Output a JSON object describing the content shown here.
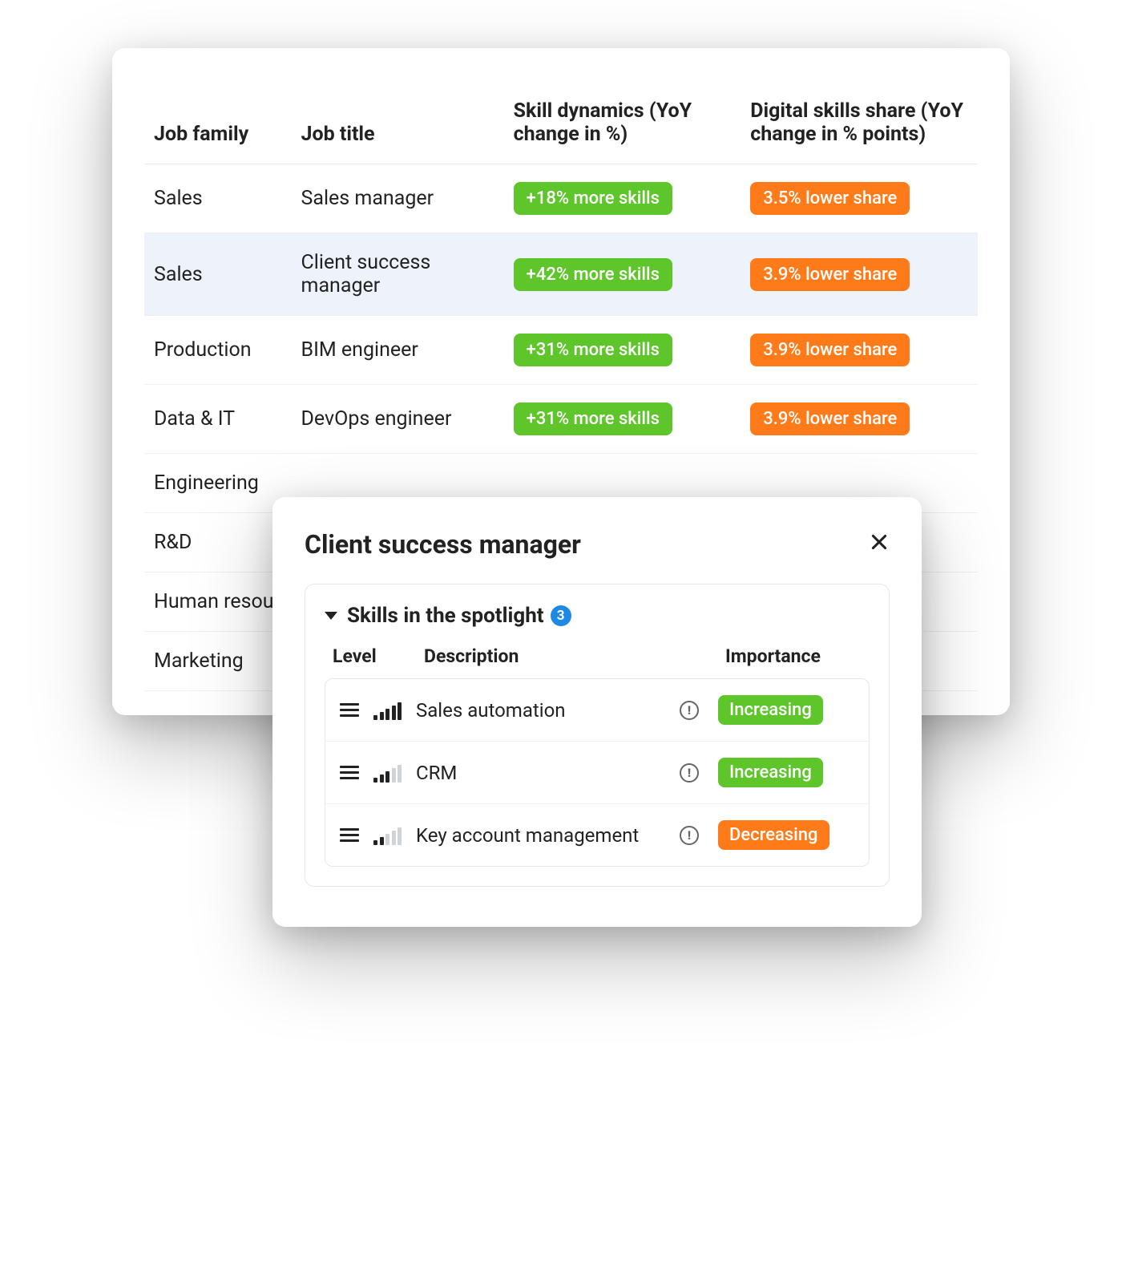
{
  "table": {
    "headers": {
      "job_family": "Job family",
      "job_title": "Job title",
      "skill_dynamics": "Skill dynamics (YoY change in %)",
      "digital_share": "Digital skills share (YoY change in % points)"
    },
    "rows": [
      {
        "family": "Sales",
        "title": "Sales manager",
        "skill": "+18% more skills",
        "share": "3.5%  lower share",
        "selected": false
      },
      {
        "family": "Sales",
        "title": "Client success manager",
        "skill": "+42% more skills",
        "share": "3.9%  lower share",
        "selected": true
      },
      {
        "family": "Production",
        "title": "BIM engineer",
        "skill": "+31% more skills",
        "share": "3.9%  lower share",
        "selected": false
      },
      {
        "family": "Data & IT",
        "title": "DevOps engineer",
        "skill": "+31% more skills",
        "share": "3.9%  lower share",
        "selected": false
      },
      {
        "family": "Engineering",
        "title": "",
        "skill": "",
        "share": "",
        "selected": false
      },
      {
        "family": "R&D",
        "title": "",
        "skill": "",
        "share": "",
        "selected": false
      },
      {
        "family": "Human resources",
        "title": "",
        "skill": "",
        "share": "",
        "selected": false
      },
      {
        "family": "Marketing",
        "title": "",
        "skill": "",
        "share": "",
        "selected": false
      }
    ]
  },
  "modal": {
    "title": "Client success manager",
    "section_label": "Skills in the spotlight",
    "count": "3",
    "headers": {
      "level": "Level",
      "description": "Description",
      "importance": "Importance"
    },
    "skills": [
      {
        "desc": "Sales automation",
        "importance": "Increasing",
        "trend": "up",
        "level": 5
      },
      {
        "desc": "CRM",
        "importance": "Increasing",
        "trend": "up",
        "level": 3
      },
      {
        "desc": "Key account management",
        "importance": "Decreasing",
        "trend": "down",
        "level": 2
      }
    ]
  }
}
